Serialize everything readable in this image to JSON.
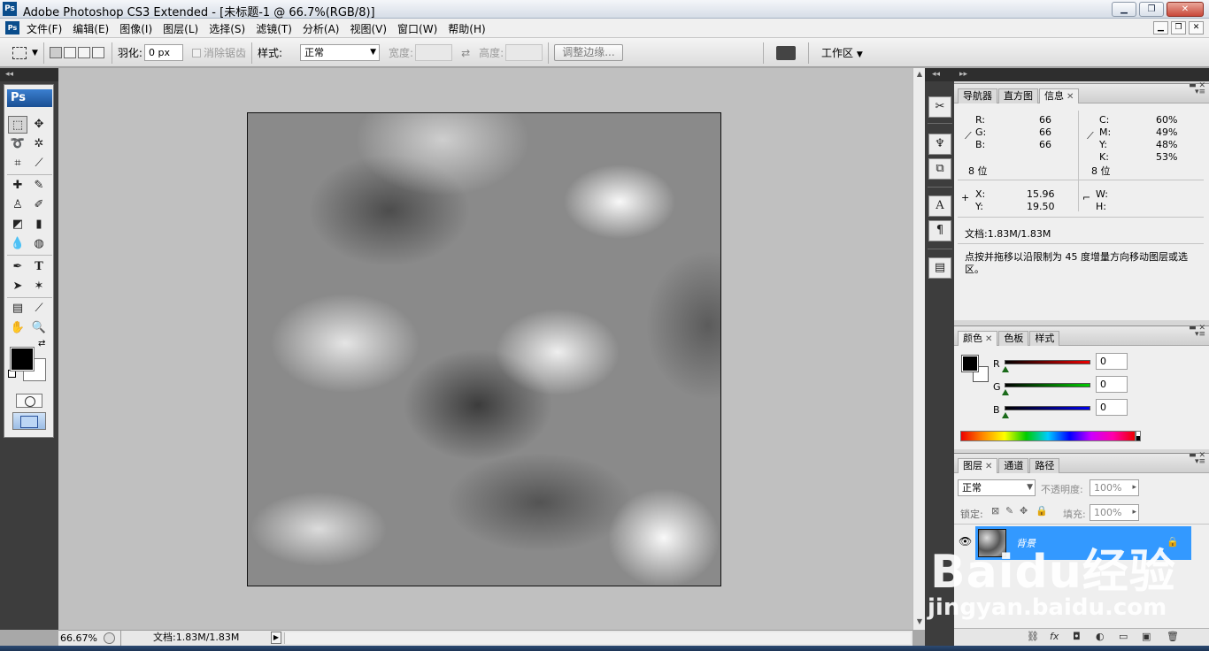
{
  "window": {
    "title": "Adobe Photoshop CS3 Extended - [未标题-1 @ 66.7%(RGB/8)]",
    "app_icon": "Ps",
    "controls": [
      "minimize",
      "maximize",
      "close"
    ]
  },
  "menu": {
    "items": [
      "文件(F)",
      "编辑(E)",
      "图像(I)",
      "图层(L)",
      "选择(S)",
      "滤镜(T)",
      "分析(A)",
      "视图(V)",
      "窗口(W)",
      "帮助(H)"
    ]
  },
  "options": {
    "feather_label": "羽化:",
    "feather_value": "0 px",
    "antialias_label": "消除锯齿",
    "style_label": "样式:",
    "style_value": "正常",
    "width_label": "宽度:",
    "height_label": "高度:",
    "refine_edge": "调整边缘...",
    "workspace": "工作区"
  },
  "toolbox": {
    "header": "Ps"
  },
  "status": {
    "zoom": "66.67%",
    "doc": "文档:1.83M/1.83M"
  },
  "info_panel": {
    "tabs": [
      "导航器",
      "直方图",
      "信息"
    ],
    "active_tab": "信息",
    "rgb": {
      "R": "66",
      "G": "66",
      "B": "66",
      "bits": "8 位"
    },
    "cmyk": {
      "C": "60%",
      "M": "49%",
      "Y": "48%",
      "K": "53%",
      "bits": "8 位"
    },
    "xy": {
      "X": "15.96",
      "Y": "19.50"
    },
    "wh": {
      "W": "",
      "H": ""
    },
    "doc": "文档:1.83M/1.83M",
    "hint": "点按并拖移以沿限制为 45 度增量方向移动图层或选区。",
    "labels": {
      "R": "R:",
      "G": "G:",
      "B": "B:",
      "C": "C:",
      "M": "M:",
      "Y": "Y:",
      "K": "K:",
      "X": "X:",
      "Yc": "Y:",
      "W": "W:",
      "H": "H:"
    }
  },
  "color_panel": {
    "tabs": [
      "颜色",
      "色板",
      "样式"
    ],
    "active_tab": "颜色",
    "R": {
      "label": "R",
      "value": "0",
      "color": "#cc0000"
    },
    "G": {
      "label": "G",
      "value": "0",
      "color": "#00aa00"
    },
    "B": {
      "label": "B",
      "value": "0",
      "color": "#0000cc"
    }
  },
  "layers_panel": {
    "tabs": [
      "图层",
      "通道",
      "路径"
    ],
    "active_tab": "图层",
    "blend_mode": "正常",
    "opacity_label": "不透明度:",
    "opacity": "100%",
    "lock_label": "锁定:",
    "fill_label": "填充:",
    "fill": "100%",
    "layers": [
      {
        "name": "背景",
        "visible": true,
        "locked": true,
        "selected": true
      }
    ]
  },
  "watermark": {
    "brand": "Baidu经验",
    "url": "jingyan.baidu.com"
  },
  "colors": {
    "selection": "#3399ff",
    "toolbox_header": "#1a4f93",
    "workarea": "#c0c0c0"
  }
}
